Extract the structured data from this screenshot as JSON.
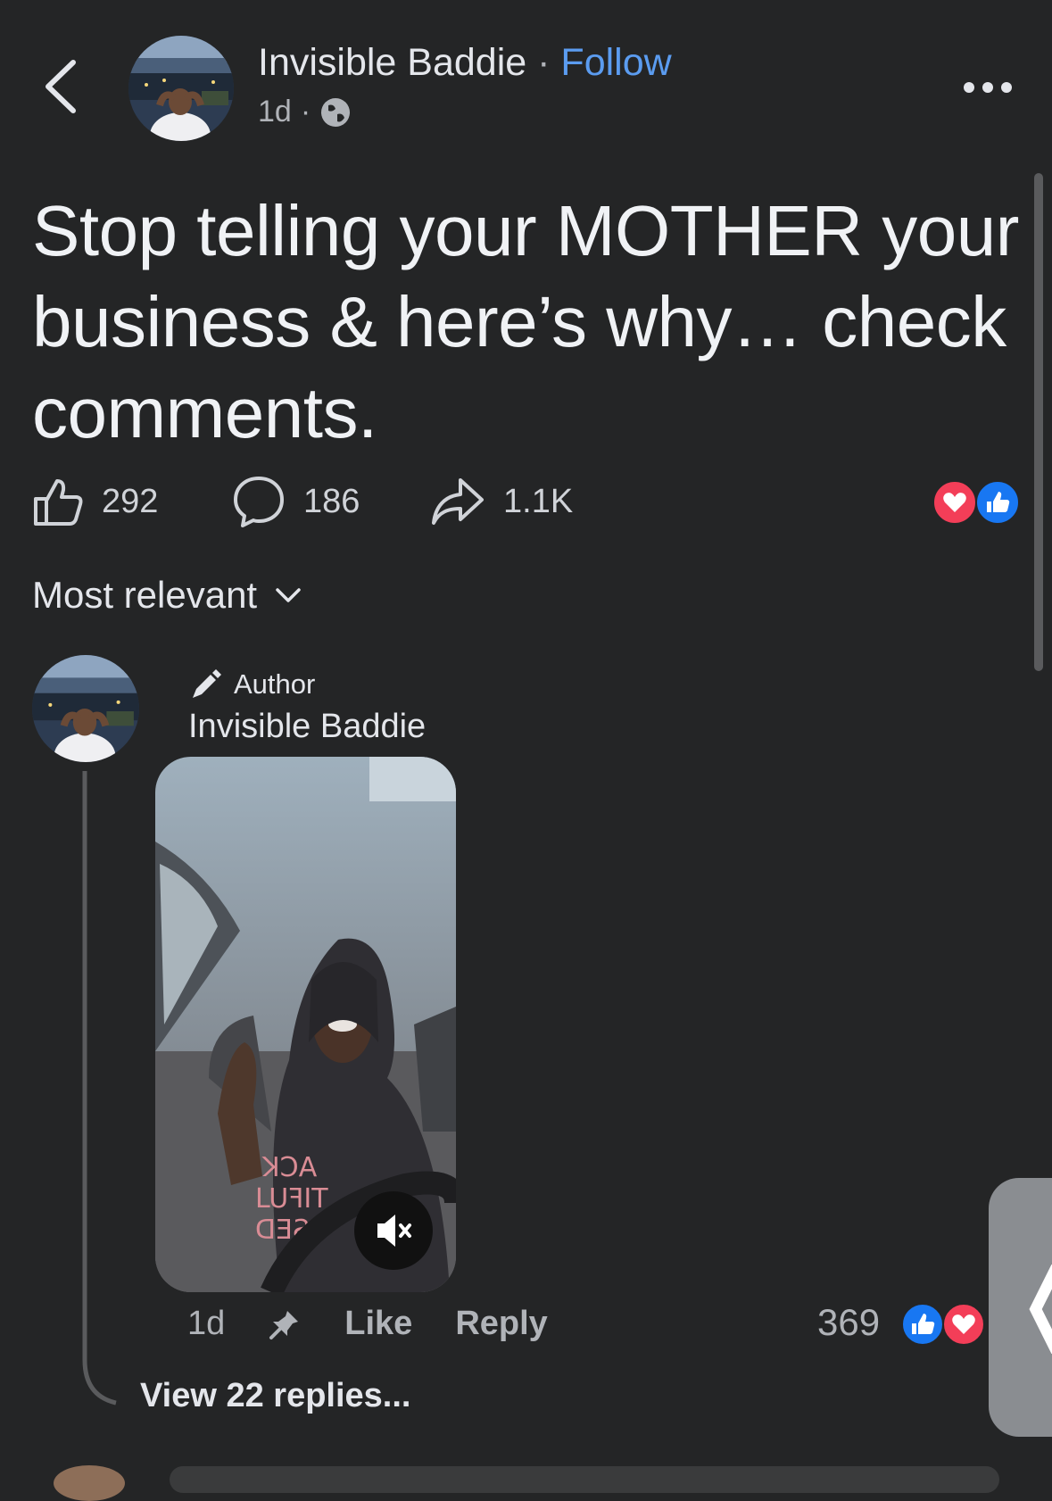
{
  "header": {
    "author_name": "Invisible Baddie",
    "separator": " · ",
    "follow_label": "Follow",
    "time": "1d",
    "meta_separator": "·",
    "privacy_icon": "globe-icon",
    "back_icon": "chevron-left-icon",
    "more_icon": "more-horizontal-icon"
  },
  "post": {
    "text": "Stop telling your MOTHER your business & here’s why… check comments.",
    "likes": "292",
    "comments": "186",
    "shares": "1.1K",
    "reactions": [
      "love",
      "like"
    ]
  },
  "sort": {
    "label": "Most relevant",
    "icon": "chevron-down-icon"
  },
  "comment": {
    "badge": "Author",
    "badge_icon": "pen-icon",
    "name": "Invisible Baddie",
    "time": "1d",
    "pin_icon": "pin-icon",
    "like_label": "Like",
    "reply_label": "Reply",
    "reaction_count": "369",
    "reactions": [
      "like",
      "love"
    ],
    "mute_icon": "muted-speaker-icon",
    "view_replies": "View 22 replies..."
  },
  "side_tab": {
    "glyph": "❬"
  },
  "colors": {
    "background": "#242526",
    "follow": "#5b9cf0",
    "like_blue": "#1877f2",
    "love_red": "#f33e58"
  }
}
